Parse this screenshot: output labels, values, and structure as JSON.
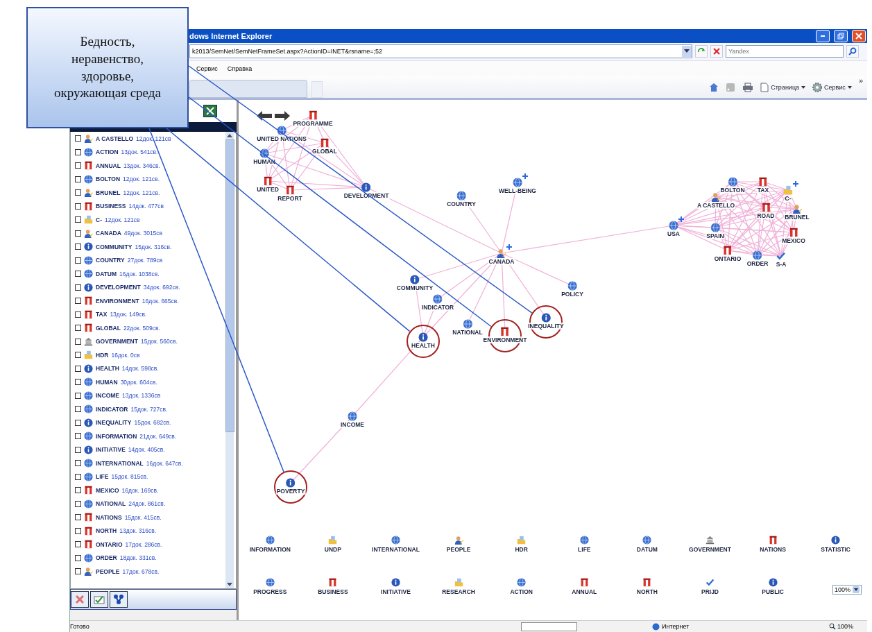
{
  "callout": {
    "text": "Бедность, неравенство, здоровье, окружающая среда"
  },
  "window": {
    "title": "dows Internet Explorer",
    "address": "k2013/SemNet/SemNetFrameSet.aspx?ActionID=INET&rsname=;52",
    "search_placeholder": "Yandex",
    "menu": [
      "Сервис",
      "Справка"
    ],
    "toolbar": [
      {
        "label": "Страница",
        "kind": "page"
      },
      {
        "label": "Сервис",
        "kind": "gear"
      }
    ],
    "chevron": "»"
  },
  "panel": {
    "items": [
      {
        "name": "A CASTELLO",
        "count": "12док. 121св",
        "kind": "person",
        "checked": false
      },
      {
        "name": "ACTION",
        "count": "13док. 541св.",
        "kind": "globe",
        "checked": false
      },
      {
        "name": "ANNUAL",
        "count": "13док. 346св.",
        "kind": "book",
        "checked": false
      },
      {
        "name": "BOLTON",
        "count": "12док. 121св.",
        "kind": "globe",
        "checked": false
      },
      {
        "name": "BRUNEL",
        "count": "12док. 121св.",
        "kind": "person",
        "checked": false
      },
      {
        "name": "BUSINESS",
        "count": "14док. 477св",
        "kind": "book",
        "checked": false
      },
      {
        "name": "C-",
        "count": "12док. 121св",
        "kind": "folder",
        "checked": false
      },
      {
        "name": "CANADA",
        "count": "49док. 3015св",
        "kind": "person",
        "checked": false
      },
      {
        "name": "COMMUNITY",
        "count": "15док. 316св.",
        "kind": "info",
        "checked": false
      },
      {
        "name": "COUNTRY",
        "count": "27док. 789св",
        "kind": "globe",
        "checked": false
      },
      {
        "name": "DATUM",
        "count": "16док. 1038св.",
        "kind": "globe",
        "checked": false
      },
      {
        "name": "DEVELOPMENT",
        "count": "34док. 692св.",
        "kind": "info",
        "checked": false
      },
      {
        "name": "ENVIRONMENT",
        "count": "16док. 665св.",
        "kind": "book",
        "checked": false
      },
      {
        "name": "TAX",
        "count": "13док. 149св.",
        "kind": "book",
        "checked": false
      },
      {
        "name": "GLOBAL",
        "count": "22док. 509св.",
        "kind": "book",
        "checked": false
      },
      {
        "name": "GOVERNMENT",
        "count": "15док. 560св.",
        "kind": "building",
        "checked": false
      },
      {
        "name": "HDR",
        "count": "16док. 0св",
        "kind": "folder",
        "checked": false
      },
      {
        "name": "HEALTH",
        "count": "14док. 598св.",
        "kind": "info",
        "checked": false
      },
      {
        "name": "HUMAN",
        "count": "30док. 604св.",
        "kind": "globe",
        "checked": false
      },
      {
        "name": "INCOME",
        "count": "13док. 1336св",
        "kind": "globe",
        "checked": false
      },
      {
        "name": "INDICATOR",
        "count": "15док. 727св.",
        "kind": "globe",
        "checked": false
      },
      {
        "name": "INEQUALITY",
        "count": "15док. 682св.",
        "kind": "info",
        "checked": false
      },
      {
        "name": "INFORMATION",
        "count": "21док. 649св.",
        "kind": "globe",
        "checked": false
      },
      {
        "name": "INITIATIVE",
        "count": "14док. 405св.",
        "kind": "info",
        "checked": false
      },
      {
        "name": "INTERNATIONAL",
        "count": "16док. 647св.",
        "kind": "globe",
        "checked": false
      },
      {
        "name": "LIFE",
        "count": "15док. 815св.",
        "kind": "globe",
        "checked": false
      },
      {
        "name": "MEXICO",
        "count": "16док. 169св.",
        "kind": "book",
        "checked": false
      },
      {
        "name": "NATIONAL",
        "count": "24док. 861св.",
        "kind": "globe",
        "checked": false
      },
      {
        "name": "NATIONS",
        "count": "15док. 415св.",
        "kind": "book",
        "checked": false
      },
      {
        "name": "NORTH",
        "count": "13док. 316св.",
        "kind": "book",
        "checked": false
      },
      {
        "name": "ONTARIO",
        "count": "17док. 286св.",
        "kind": "book",
        "checked": false
      },
      {
        "name": "ORDER",
        "count": "18док. 331св.",
        "kind": "globe",
        "checked": false
      },
      {
        "name": "PEOPLE",
        "count": "17док. 678св.",
        "kind": "person",
        "checked": false
      }
    ]
  },
  "graph": {
    "nodes": [
      {
        "label": "PROGRAMME",
        "kind": "book",
        "highlighted": false,
        "expandable": false
      },
      {
        "label": "UNITED NATIONS",
        "kind": "globe",
        "highlighted": false,
        "expandable": false
      },
      {
        "label": "GLOBAL",
        "kind": "book",
        "highlighted": false,
        "expandable": false
      },
      {
        "label": "HUMAN",
        "kind": "globe",
        "highlighted": false,
        "expandable": false
      },
      {
        "label": "UNITED",
        "kind": "book",
        "highlighted": false,
        "expandable": false
      },
      {
        "label": "REPORT",
        "kind": "book",
        "highlighted": false,
        "expandable": false
      },
      {
        "label": "DEVELOPMENT",
        "kind": "info",
        "highlighted": false,
        "expandable": false
      },
      {
        "label": "COUNTRY",
        "kind": "globe",
        "highlighted": false,
        "expandable": false
      },
      {
        "label": "WELL-BEING",
        "kind": "globe",
        "highlighted": false,
        "expandable": true
      },
      {
        "label": "CANADA",
        "kind": "person",
        "highlighted": false,
        "expandable": true
      },
      {
        "label": "COMMUNITY",
        "kind": "info",
        "highlighted": false,
        "expandable": false
      },
      {
        "label": "INDICATOR",
        "kind": "globe",
        "highlighted": false,
        "expandable": false
      },
      {
        "label": "NATIONAL",
        "kind": "globe",
        "highlighted": false,
        "expandable": false
      },
      {
        "label": "HEALTH",
        "kind": "info",
        "highlighted": true,
        "expandable": false
      },
      {
        "label": "ENVIRONMENT",
        "kind": "book",
        "highlighted": true,
        "expandable": false
      },
      {
        "label": "INEQUALITY",
        "kind": "info",
        "highlighted": true,
        "expandable": false
      },
      {
        "label": "POLICY",
        "kind": "globe",
        "highlighted": false,
        "expandable": false
      },
      {
        "label": "INCOME",
        "kind": "globe",
        "highlighted": false,
        "expandable": false
      },
      {
        "label": "POVERTY",
        "kind": "info",
        "highlighted": true,
        "expandable": false
      },
      {
        "label": "USA",
        "kind": "globe",
        "highlighted": false,
        "expandable": true
      },
      {
        "label": "BOLTON",
        "kind": "globe",
        "highlighted": false,
        "expandable": false
      },
      {
        "label": "TAX",
        "kind": "book",
        "highlighted": false,
        "expandable": false
      },
      {
        "label": "C-",
        "kind": "folder",
        "highlighted": false,
        "expandable": true
      },
      {
        "label": "A CASTELLO",
        "kind": "person",
        "highlighted": false,
        "expandable": false
      },
      {
        "label": "ROAD",
        "kind": "book",
        "highlighted": false,
        "expandable": false
      },
      {
        "label": "BRUNEL",
        "kind": "person",
        "highlighted": false,
        "expandable": false
      },
      {
        "label": "SPAIN",
        "kind": "globe",
        "highlighted": false,
        "expandable": false
      },
      {
        "label": "MEXICO",
        "kind": "book",
        "highlighted": false,
        "expandable": false
      },
      {
        "label": "ONTARIO",
        "kind": "book",
        "highlighted": false,
        "expandable": false
      },
      {
        "label": "ORDER",
        "kind": "globe",
        "highlighted": false,
        "expandable": false
      },
      {
        "label": "S-A",
        "kind": "check",
        "highlighted": false,
        "expandable": false
      }
    ],
    "free_nodes": [
      {
        "label": "INFORMATION",
        "kind": "globe"
      },
      {
        "label": "UNDP",
        "kind": "folder"
      },
      {
        "label": "INTERNATIONAL",
        "kind": "globe"
      },
      {
        "label": "PEOPLE",
        "kind": "person"
      },
      {
        "label": "HDR",
        "kind": "folder"
      },
      {
        "label": "LIFE",
        "kind": "globe"
      },
      {
        "label": "DATUM",
        "kind": "globe"
      },
      {
        "label": "GOVERNMENT",
        "kind": "building"
      },
      {
        "label": "NATIONS",
        "kind": "book"
      },
      {
        "label": "STATISTIC",
        "kind": "info"
      },
      {
        "label": "PROGRESS",
        "kind": "globe"
      },
      {
        "label": "BUSINESS",
        "kind": "book"
      },
      {
        "label": "INITIATIVE",
        "kind": "info"
      },
      {
        "label": "RESEARCH",
        "kind": "folder"
      },
      {
        "label": "ACTION",
        "kind": "globe"
      },
      {
        "label": "ANNUAL",
        "kind": "book"
      },
      {
        "label": "NORTH",
        "kind": "book"
      },
      {
        "label": "PRIJD",
        "kind": "check"
      },
      {
        "label": "PUBLIC",
        "kind": "info"
      }
    ],
    "zoom": "100%"
  },
  "status_bar": {
    "text": "Готово",
    "zone": "Интернет",
    "zoom": "100%"
  }
}
